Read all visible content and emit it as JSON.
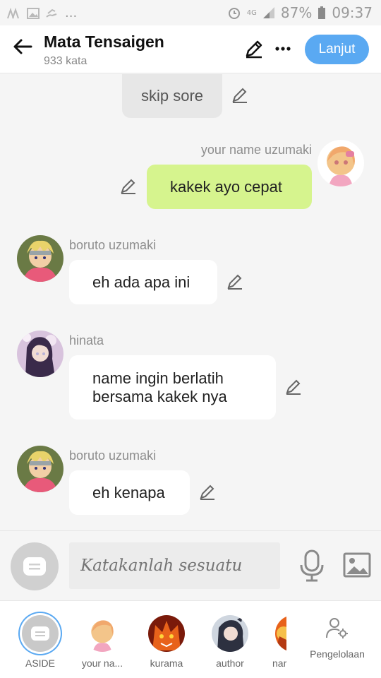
{
  "status": {
    "battery": "87%",
    "time": "09:37",
    "network": "4G",
    "dots": "..."
  },
  "header": {
    "title": "Mata Tensaigen",
    "subtitle": "933 kata",
    "next_label": "Lanjut"
  },
  "messages": [
    {
      "type": "system",
      "text": "skip sore"
    },
    {
      "type": "me",
      "sender": "your name uzumaki",
      "text": "kakek ayo cepat"
    },
    {
      "type": "other",
      "sender": "boruto uzumaki",
      "text": "eh ada apa ini"
    },
    {
      "type": "other",
      "sender": "hinata",
      "text": "name ingin berlatih bersama kakek nya"
    },
    {
      "type": "other",
      "sender": "boruto uzumaki",
      "text": "eh kenapa"
    }
  ],
  "composer": {
    "placeholder": "Katakanlah sesuatu"
  },
  "dock": {
    "items": [
      {
        "label": "ASIDE"
      },
      {
        "label": "your na..."
      },
      {
        "label": "kurama"
      },
      {
        "label": "author"
      },
      {
        "label": "nar"
      }
    ],
    "manage_label": "Pengelolaan"
  },
  "colors": {
    "accent": "#5aa9f2",
    "me_bubble": "#d6f48e",
    "avatar_ring": "#5aa9f2"
  },
  "icons": [
    "back-arrow-icon",
    "pencil-icon",
    "more-icon",
    "comment-icon",
    "microphone-icon",
    "image-icon",
    "person-gear-icon"
  ]
}
